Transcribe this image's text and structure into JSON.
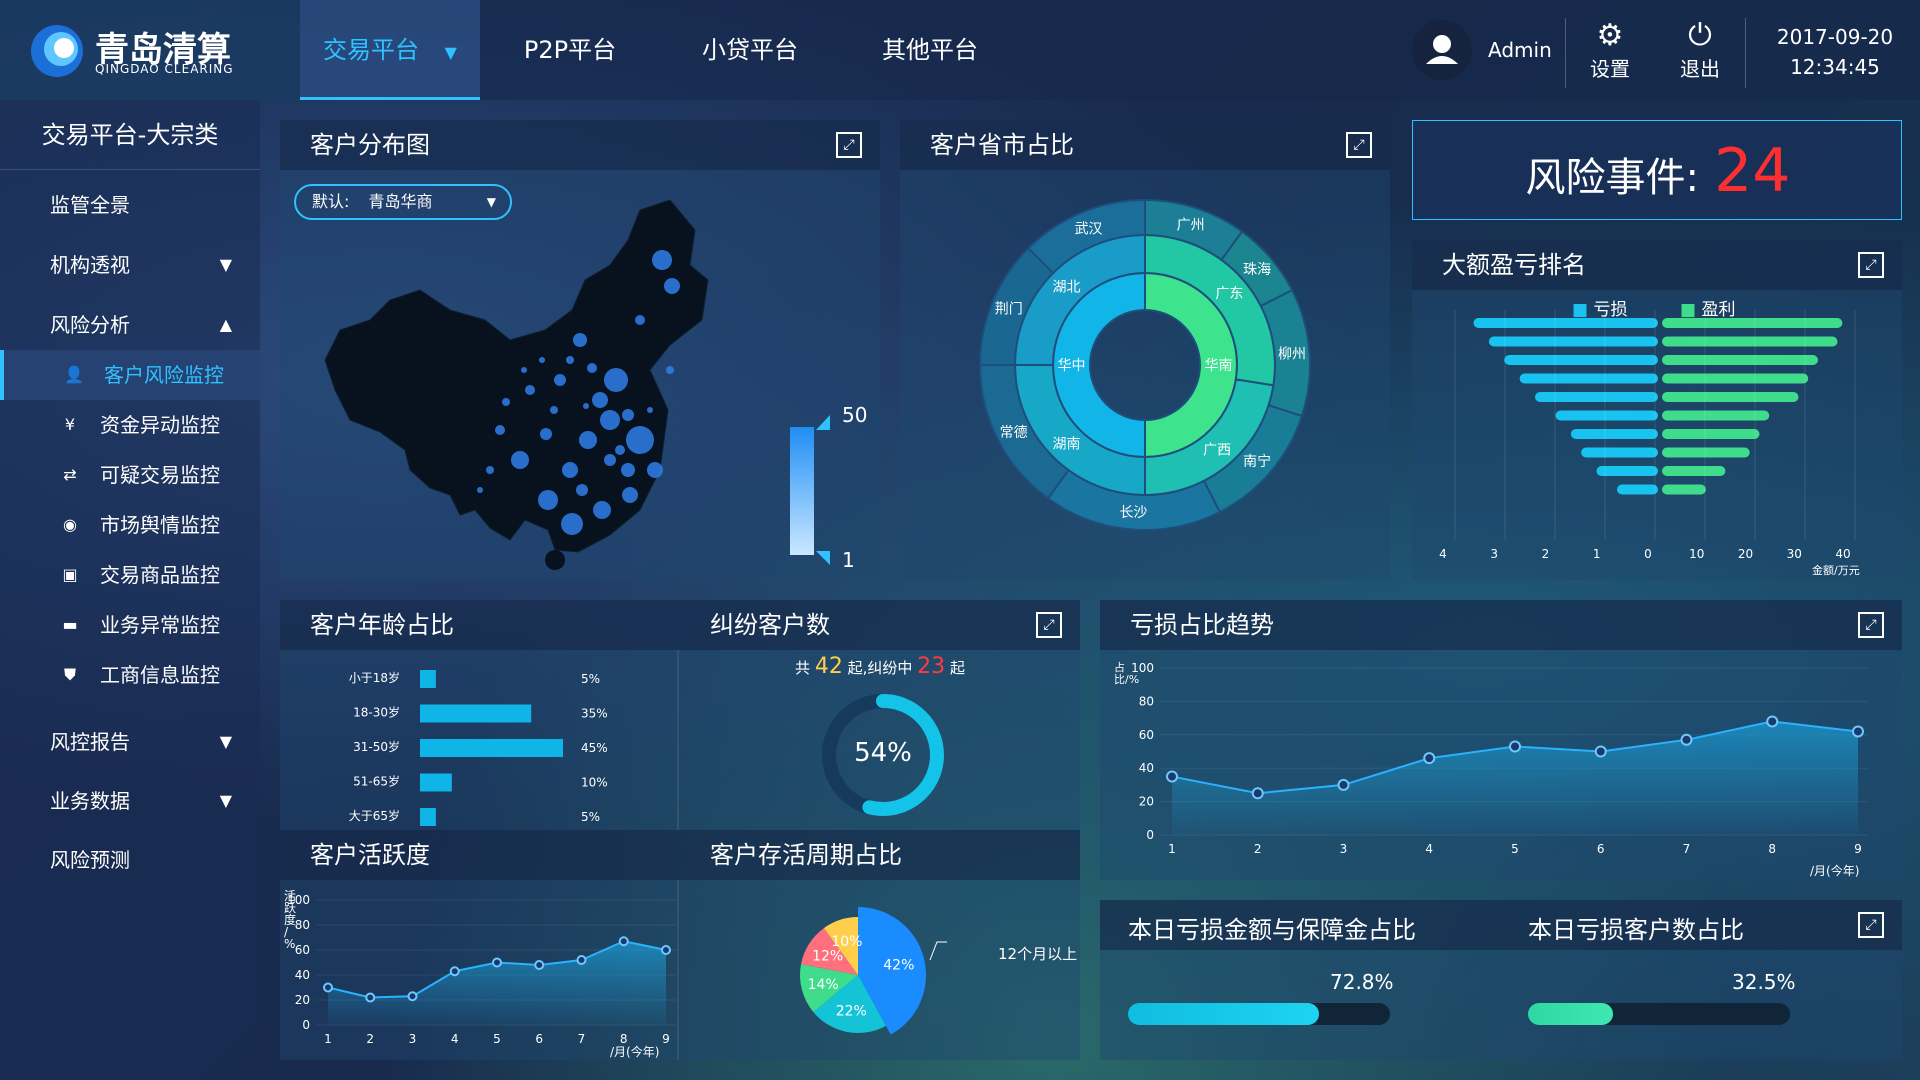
{
  "header": {
    "logo_cn": "青岛清算",
    "logo_en": "QINGDAO CLEARING",
    "nav": [
      {
        "label": "交易平台",
        "active": true
      },
      {
        "label": "P2P平台"
      },
      {
        "label": "小贷平台"
      },
      {
        "label": "其他平台"
      }
    ],
    "user": "Admin",
    "settings": "设置",
    "logout": "退出",
    "date": "2017-09-20",
    "time": "12:34:45"
  },
  "sidebar": {
    "title": "交易平台-大宗类",
    "items": [
      {
        "label": "监管全景"
      },
      {
        "label": "机构透视"
      },
      {
        "label": "风险分析"
      }
    ],
    "sub": [
      {
        "label": "客户风险监控",
        "icon": "user-icon",
        "active": true
      },
      {
        "label": "资金异动监控",
        "icon": "yen-icon"
      },
      {
        "label": "可疑交易监控",
        "icon": "trade-icon"
      },
      {
        "label": "市场舆情监控",
        "icon": "target-icon"
      },
      {
        "label": "交易商品监控",
        "icon": "bag-icon"
      },
      {
        "label": "业务异常监控",
        "icon": "folder-icon"
      },
      {
        "label": "工商信息监控",
        "icon": "badge-icon"
      }
    ],
    "items2": [
      {
        "label": "风控报告"
      },
      {
        "label": "业务数据"
      },
      {
        "label": "风险预测"
      }
    ]
  },
  "map_panel": {
    "title": "客户分布图",
    "select_prefix": "默认:",
    "select_value": "青岛华商",
    "legend_max": "50",
    "legend_min": "1"
  },
  "province_panel": {
    "title": "客户省市占比",
    "inner": [
      "华中",
      "华南"
    ],
    "middle": [
      "湖北",
      "湖南",
      "广东",
      "广西"
    ],
    "outer": [
      "武汉",
      "荆门",
      "常德",
      "长沙",
      "南宁",
      "柳州",
      "珠海",
      "广州"
    ]
  },
  "risk": {
    "label": "风险事件:",
    "value": "24"
  },
  "ranking_panel": {
    "title": "大额盈亏排名",
    "legend_loss": "亏损",
    "legend_profit": "盈利",
    "unit": "金额/万元",
    "loss_ticks": [
      "4",
      "3",
      "2",
      "1",
      "0"
    ],
    "profit_ticks": [
      "10",
      "20",
      "30",
      "40"
    ]
  },
  "age_panel": {
    "title": "客户年龄占比"
  },
  "dispute_panel": {
    "title": "纠纷客户数",
    "prefix": "共",
    "total": "42",
    "mid": "起,纠纷中",
    "disputed": "23",
    "suffix": "起",
    "percent": "54%"
  },
  "trend_panel": {
    "title": "亏损占比趋势",
    "ylabel": "占比/%",
    "xlabel": "/月(今年)"
  },
  "activity_panel": {
    "title": "客户活跃度",
    "ylabel": "活跃度/%",
    "xlabel": "/月(今年)"
  },
  "lifecycle_panel": {
    "title": "客户存活周期占比",
    "callout": "12个月以上"
  },
  "loss_amount_panel": {
    "title": "本日亏损金额与保障金占比",
    "percent": "72.8%"
  },
  "loss_customer_panel": {
    "title": "本日亏损客户数占比",
    "percent": "32.5%"
  },
  "chart_data": [
    {
      "type": "bar",
      "title": "客户年龄占比",
      "categories": [
        "小于18岁",
        "18-30岁",
        "31-50岁",
        "51-65岁",
        "大于65岁"
      ],
      "values": [
        5,
        35,
        45,
        10,
        5
      ],
      "value_labels": [
        "5%",
        "35%",
        "45%",
        "10%",
        "5%"
      ]
    },
    {
      "type": "bar",
      "title": "大额盈亏排名",
      "series": [
        {
          "name": "亏损",
          "values": [
            3.6,
            3.3,
            3.0,
            2.7,
            2.4,
            2.0,
            1.7,
            1.5,
            1.2,
            0.8
          ]
        },
        {
          "name": "盈利",
          "values": [
            37,
            36,
            32,
            30,
            28,
            22,
            20,
            18,
            13,
            9
          ]
        }
      ],
      "xlim_loss": [
        0,
        4
      ],
      "xlim_profit": [
        0,
        40
      ]
    },
    {
      "type": "line",
      "title": "亏损占比趋势",
      "x": [
        1,
        2,
        3,
        4,
        5,
        6,
        7,
        8,
        9
      ],
      "y": [
        35,
        25,
        30,
        46,
        53,
        50,
        57,
        68,
        62
      ],
      "ylim": [
        0,
        100
      ],
      "yticks": [
        0,
        20,
        40,
        60,
        80,
        100
      ]
    },
    {
      "type": "line",
      "title": "客户活跃度",
      "x": [
        1,
        2,
        3,
        4,
        5,
        6,
        7,
        8,
        9
      ],
      "y": [
        30,
        22,
        23,
        43,
        50,
        48,
        52,
        67,
        60
      ],
      "ylim": [
        0,
        100
      ],
      "yticks": [
        0,
        20,
        40,
        60,
        80,
        100
      ]
    },
    {
      "type": "pie",
      "title": "客户存活周期占比",
      "labels": [
        "12个月以上",
        "",
        "",
        "",
        ""
      ],
      "values": [
        42,
        22,
        14,
        12,
        10
      ],
      "value_labels": [
        "42%",
        "22%",
        "14%",
        "12%",
        "10%"
      ],
      "colors": [
        "#1a8cff",
        "#14c3d6",
        "#3fdc8c",
        "#ff6f7d",
        "#ffce4a"
      ]
    }
  ]
}
